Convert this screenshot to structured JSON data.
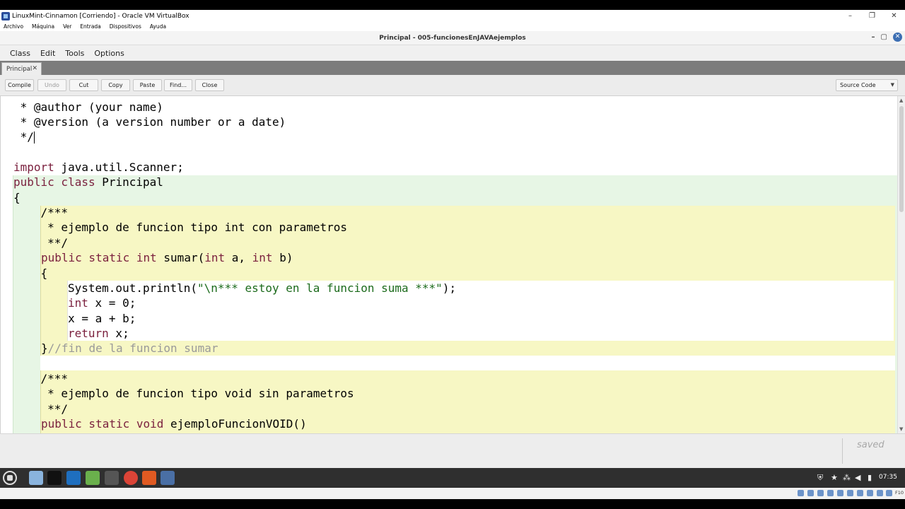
{
  "vbox": {
    "title": "LinuxMint-Cinnamon [Corriendo] - Oracle VM VirtualBox",
    "window_buttons": [
      "–",
      "❐",
      "✕"
    ],
    "menu": [
      "Archivo",
      "Máquina",
      "Ver",
      "Entrada",
      "Dispositivos",
      "Ayuda"
    ],
    "host_key": "F10"
  },
  "editor": {
    "title": "Principal - 005-funcionesEnJAVAejemplos",
    "window_buttons": [
      "–",
      "▢",
      "✕"
    ],
    "menu": [
      "Class",
      "Edit",
      "Tools",
      "Options"
    ],
    "tab": {
      "label": "Principal",
      "close": "✕"
    },
    "toolbar": {
      "compile": "Compile",
      "undo": "Undo",
      "cut": "Cut",
      "copy": "Copy",
      "paste": "Paste",
      "find": "Find...",
      "close": "Close",
      "view_select": "Source Code"
    },
    "status": "saved",
    "code": [
      " * @author (your name)",
      " * @version (a version number or a date)",
      " */",
      "",
      "import java.util.Scanner;",
      "public class Principal",
      "{",
      "    /***",
      "     * ejemplo de funcion tipo int con parametros",
      "     **/",
      "    public static int sumar(int a, int b)",
      "    {",
      "        System.out.println(\"\\n*** estoy en la funcion suma ***\");",
      "        int x = 0;",
      "        x = a + b;",
      "        return x;",
      "    }//fin de la funcion sumar",
      "",
      "    /***",
      "     * ejemplo de funcion tipo void sin parametros",
      "     **/",
      "    public static void ejemploFuncionVOID()"
    ],
    "code_parts": {
      "import_kw": "import",
      "import_rest": " java.util.Scanner;",
      "public_kw": "public",
      "class_kw": " class",
      "class_name": " Principal",
      "static_kw": "public static",
      "int_kw": "int",
      "void_kw": "void",
      "sumar_sig_a": " sumar(",
      "sumar_sig_b": " a, ",
      "sumar_sig_c": " b)",
      "println_prefix": "System.out.println(",
      "println_str": "\"\\n*** estoy en la funcion suma ***\"",
      "println_suffix": ");",
      "int_x_rest": " x = 0;",
      "return_kw": "return",
      "return_rest": " x;",
      "close_brace": "}",
      "end_comment": "//fin de la funcion sumar",
      "void_name": " ejemploFuncionVOID()"
    }
  },
  "panel": {
    "clock": "07:35"
  }
}
